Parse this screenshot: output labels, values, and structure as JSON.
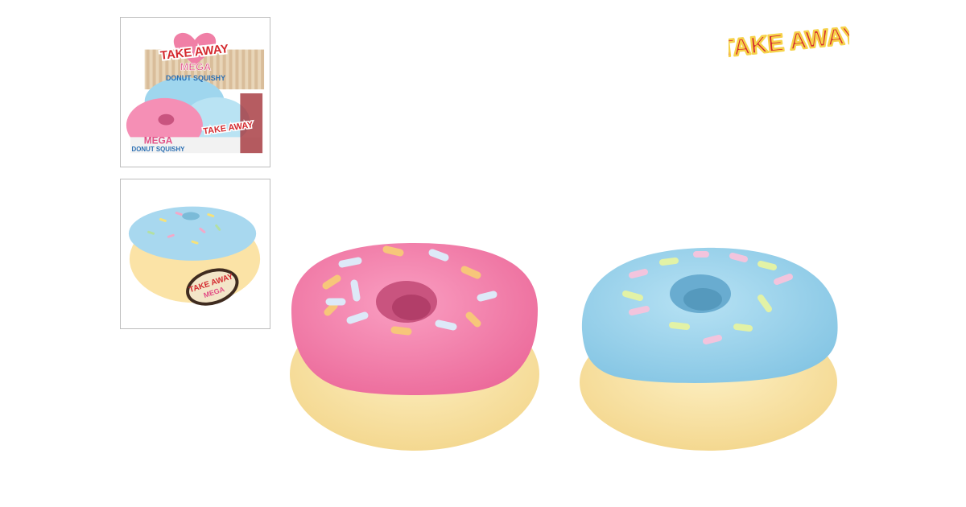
{
  "brand": {
    "logo_text": "TAKE AWAY",
    "colors": {
      "red": "#d42a2f",
      "yellow": "#f6d24a",
      "outline": "#ffffff"
    }
  },
  "thumbnails": [
    {
      "name": "display-box",
      "box_texts": [
        "TAKE AWAY",
        "MEGA",
        "DONUT SQUISHY",
        "MEGA",
        "DONUT SQUISHY",
        "TAKE AWAY"
      ]
    },
    {
      "name": "blue-donut-with-tag",
      "tag_texts": [
        "TAKE AWAY",
        "MEGA"
      ]
    }
  ],
  "product": {
    "variants": [
      {
        "name": "pink-donut",
        "icing_color": "#f58fb5"
      },
      {
        "name": "blue-donut",
        "icing_color": "#9fd6ee"
      }
    ],
    "dough_color": "#fbe3a6"
  }
}
